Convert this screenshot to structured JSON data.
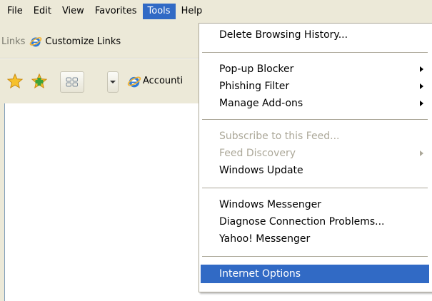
{
  "menubar": {
    "items": [
      "File",
      "Edit",
      "View",
      "Favorites",
      "Tools",
      "Help"
    ],
    "active_index": 4
  },
  "links_bar": {
    "label": "Links",
    "customize_link": "Customize Links"
  },
  "toolbar": {
    "tab_label": "Accounti"
  },
  "tools_menu": {
    "items": [
      {
        "label": "Delete Browsing History...",
        "enabled": true,
        "submenu": false
      },
      {
        "label": "Pop-up Blocker",
        "enabled": true,
        "submenu": true
      },
      {
        "label": "Phishing Filter",
        "enabled": true,
        "submenu": true
      },
      {
        "label": "Manage Add-ons",
        "enabled": true,
        "submenu": true
      },
      {
        "label": "Subscribe to this Feed...",
        "enabled": false,
        "submenu": false
      },
      {
        "label": "Feed Discovery",
        "enabled": false,
        "submenu": true
      },
      {
        "label": "Windows Update",
        "enabled": true,
        "submenu": false
      },
      {
        "label": "Windows Messenger",
        "enabled": true,
        "submenu": false
      },
      {
        "label": "Diagnose Connection Problems...",
        "enabled": true,
        "submenu": false
      },
      {
        "label": "Yahoo! Messenger",
        "enabled": true,
        "submenu": false
      },
      {
        "label": "Internet Options",
        "enabled": true,
        "submenu": false,
        "highlighted": true
      }
    ]
  },
  "colors": {
    "highlight": "#316ac5",
    "chrome": "#ece9d8",
    "disabled_text": "#aca899"
  }
}
